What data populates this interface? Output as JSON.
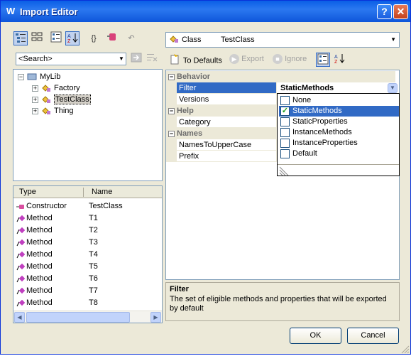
{
  "window": {
    "title": "Import Editor",
    "help_label": "?",
    "close_label": "✕"
  },
  "left_toolbar": {
    "icons": [
      "view-list-icon",
      "view-details-icon",
      "categorized-icon",
      "sort-alpha-icon",
      "braces-icon",
      "component-icon",
      "undo-icon"
    ]
  },
  "search": {
    "value": "<Search>"
  },
  "tree": {
    "root": "MyLib",
    "items": [
      {
        "label": "Factory",
        "selected": false
      },
      {
        "label": "TestClass",
        "selected": true
      },
      {
        "label": "Thing",
        "selected": false
      }
    ]
  },
  "member_list": {
    "columns": [
      "Type",
      "Name"
    ],
    "rows": [
      {
        "type": "Constructor",
        "name": "TestClass"
      },
      {
        "type": "Method",
        "name": "T1"
      },
      {
        "type": "Method",
        "name": "T2"
      },
      {
        "type": "Method",
        "name": "T3"
      },
      {
        "type": "Method",
        "name": "T4"
      },
      {
        "type": "Method",
        "name": "T5"
      },
      {
        "type": "Method",
        "name": "T6"
      },
      {
        "type": "Method",
        "name": "T7"
      },
      {
        "type": "Method",
        "name": "T8"
      }
    ]
  },
  "object_selector": {
    "kind": "Class",
    "name": "TestClass"
  },
  "right_toolbar": {
    "to_defaults": "To Defaults",
    "export": "Export",
    "ignore": "Ignore"
  },
  "property_grid": {
    "categories": [
      {
        "name": "Behavior",
        "props": [
          {
            "name": "Filter",
            "value": "StaticMethods"
          },
          {
            "name": "Versions",
            "value": ""
          }
        ]
      },
      {
        "name": "Help",
        "props": [
          {
            "name": "Category",
            "value": ""
          }
        ]
      },
      {
        "name": "Names",
        "props": [
          {
            "name": "NamesToUpperCase",
            "value": ""
          },
          {
            "name": "Prefix",
            "value": ""
          }
        ]
      }
    ],
    "toggle_minus": "−"
  },
  "filter_dropdown": {
    "options": [
      {
        "label": "None",
        "checked": false
      },
      {
        "label": "StaticMethods",
        "checked": true
      },
      {
        "label": "StaticProperties",
        "checked": false
      },
      {
        "label": "InstanceMethods",
        "checked": false
      },
      {
        "label": "InstanceProperties",
        "checked": false
      },
      {
        "label": "Default",
        "checked": false
      }
    ]
  },
  "description": {
    "title": "Filter",
    "text": "The set of eligible methods and properties that will be exported by default"
  },
  "buttons": {
    "ok": "OK",
    "cancel": "Cancel"
  },
  "colors": {
    "titlebar": "#0a5fe6",
    "selection": "#316ac5",
    "window_bg": "#ece9d8"
  }
}
